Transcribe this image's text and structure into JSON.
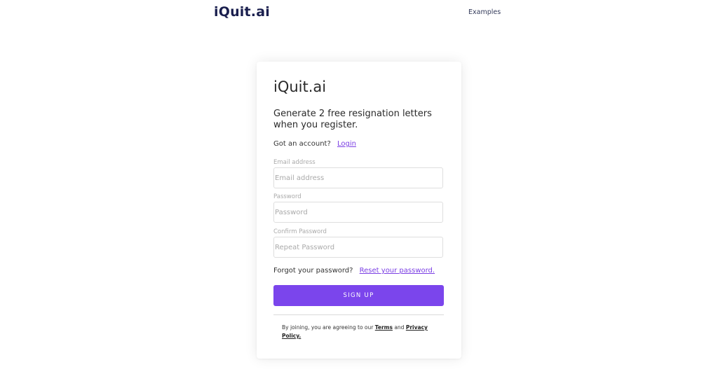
{
  "header": {
    "brand": "iQuit.ai",
    "nav_examples": "Examples"
  },
  "card": {
    "title": "iQuit.ai",
    "subtitle": "Generate 2 free resignation letters when you register.",
    "account_prompt": "Got an account?",
    "login_link": "Login",
    "email": {
      "label": "Email address",
      "placeholder": "Email address",
      "value": ""
    },
    "password": {
      "label": "Password",
      "placeholder": "Password",
      "value": ""
    },
    "confirm_password": {
      "label": "Confirm Password",
      "placeholder": "Repeat Password",
      "value": ""
    },
    "forgot_prompt": "Forgot your password?",
    "reset_link": "Reset your password.",
    "signup_button": "SIGN UP",
    "legal": {
      "prefix": "By joining, you are agreeing to our",
      "terms_link": "Terms",
      "and": "and",
      "privacy_link": "Privacy Policy."
    }
  },
  "colors": {
    "accent": "#7b45ec",
    "link": "#7b3fe4",
    "brand": "#1a1f4e"
  }
}
